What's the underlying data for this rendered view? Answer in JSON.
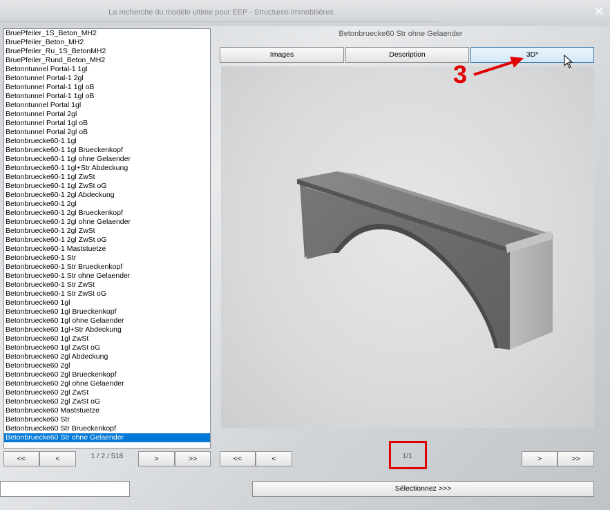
{
  "window": {
    "title": "La recherche du modèle ultime pour EEP - Structures immobilières",
    "close_glyph": "✕"
  },
  "list": {
    "items": [
      "BruePfeiler_1S_Beton_MH2",
      "BruePfeiler_Beton_MH2",
      "BruePfeiler_Ru_1S_BetonMH2",
      "BruePfeiler_Rund_Beton_MH2",
      "Betonntunnel Portal-1 1gl",
      "Betontunnel Portal-1 2gl",
      "Betontunnel Portal-1 1gl oB",
      "Betontunnel Portal-1 1gl oB",
      "Betonntunnel Portal 1gl",
      "Betontunnel Portal 2gl",
      "Betontunnel Portal 1gl oB",
      "Betontunnel Portal 2gl oB",
      "Betonbruecke60-1 1gl",
      "Betonbruecke60-1 1gl Brueckenkopf",
      "Betonbruecke60-1 1gl ohne Gelaender",
      "Betonbruecke60-1 1gl+Str Abdeckung",
      "Betonbruecke60-1 1gl ZwSt",
      "Betonbruecke60-1 1gl ZwSt oG",
      "Betonbruecke60-1 2gl Abdeckung",
      "Betonbruecke60-1 2gl",
      "Betonbruecke60-1 2gl Brueckenkopf",
      "Betonbruecke60-1 2gl ohne Gelaender",
      "Betonbruecke60-1 2gl ZwSt",
      "Betonbruecke60-1 2gl ZwSt oG",
      "Betonbruecke60-1 Maststuetze",
      "Betonbruecke60-1 Str",
      "Betonbruecke60-1 Str Brueckenkopf",
      "Betonbruecke60-1 Str ohne Gelaender",
      "Betonbruecke60-1 Str ZwSt",
      "Betonbruecke60-1 Str ZwSt oG",
      "Betonbruecke60 1gl",
      "Betonbruecke60 1gl Brueckenkopf",
      "Betonbruecke60 1gl ohne Gelaender",
      "Betonbruecke60 1gl+Str Abdeckung",
      "Betonbruecke60 1gl ZwSt",
      "Betonbruecke60 1gl ZwSt oG",
      "Betonbruecke60 2gl Abdeckung",
      "Betonbruecke60 2gl",
      "Betonbruecke60 2gl Brueckenkopf",
      "Betonbruecke60 2gl ohne Gelaender",
      "Betonbruecke60 2gl ZwSt",
      "Betonbruecke60 2gl ZwSt oG",
      "Betonbruecke60 Maststuetze",
      "Betonbruecke60 Str",
      "Betonbruecke60 Str Brueckenkopf",
      "Betonbruecke60 Str ohne Gelaender"
    ],
    "selected_index": 45,
    "page_counter": "1 / 2 / 518",
    "nav": {
      "first": "<<",
      "prev": "<",
      "next": ">",
      "last": ">>"
    }
  },
  "preview": {
    "title": "Betonbruecke60 Str ohne Gelaender",
    "tabs": {
      "images": "Images",
      "description": "Description",
      "three_d": "3D*"
    },
    "active_tab": "three_d",
    "page_counter": "1/1",
    "nav": {
      "first": "<<",
      "prev": "<",
      "next": ">",
      "last": ">>"
    }
  },
  "annotation": {
    "step_number": "3",
    "color": "#e00000"
  },
  "footer": {
    "select_label": "Sélectionnez >>>",
    "field_value": ""
  },
  "colors": {
    "selection": "#0078d7",
    "accent_border": "#3c7fb1"
  }
}
